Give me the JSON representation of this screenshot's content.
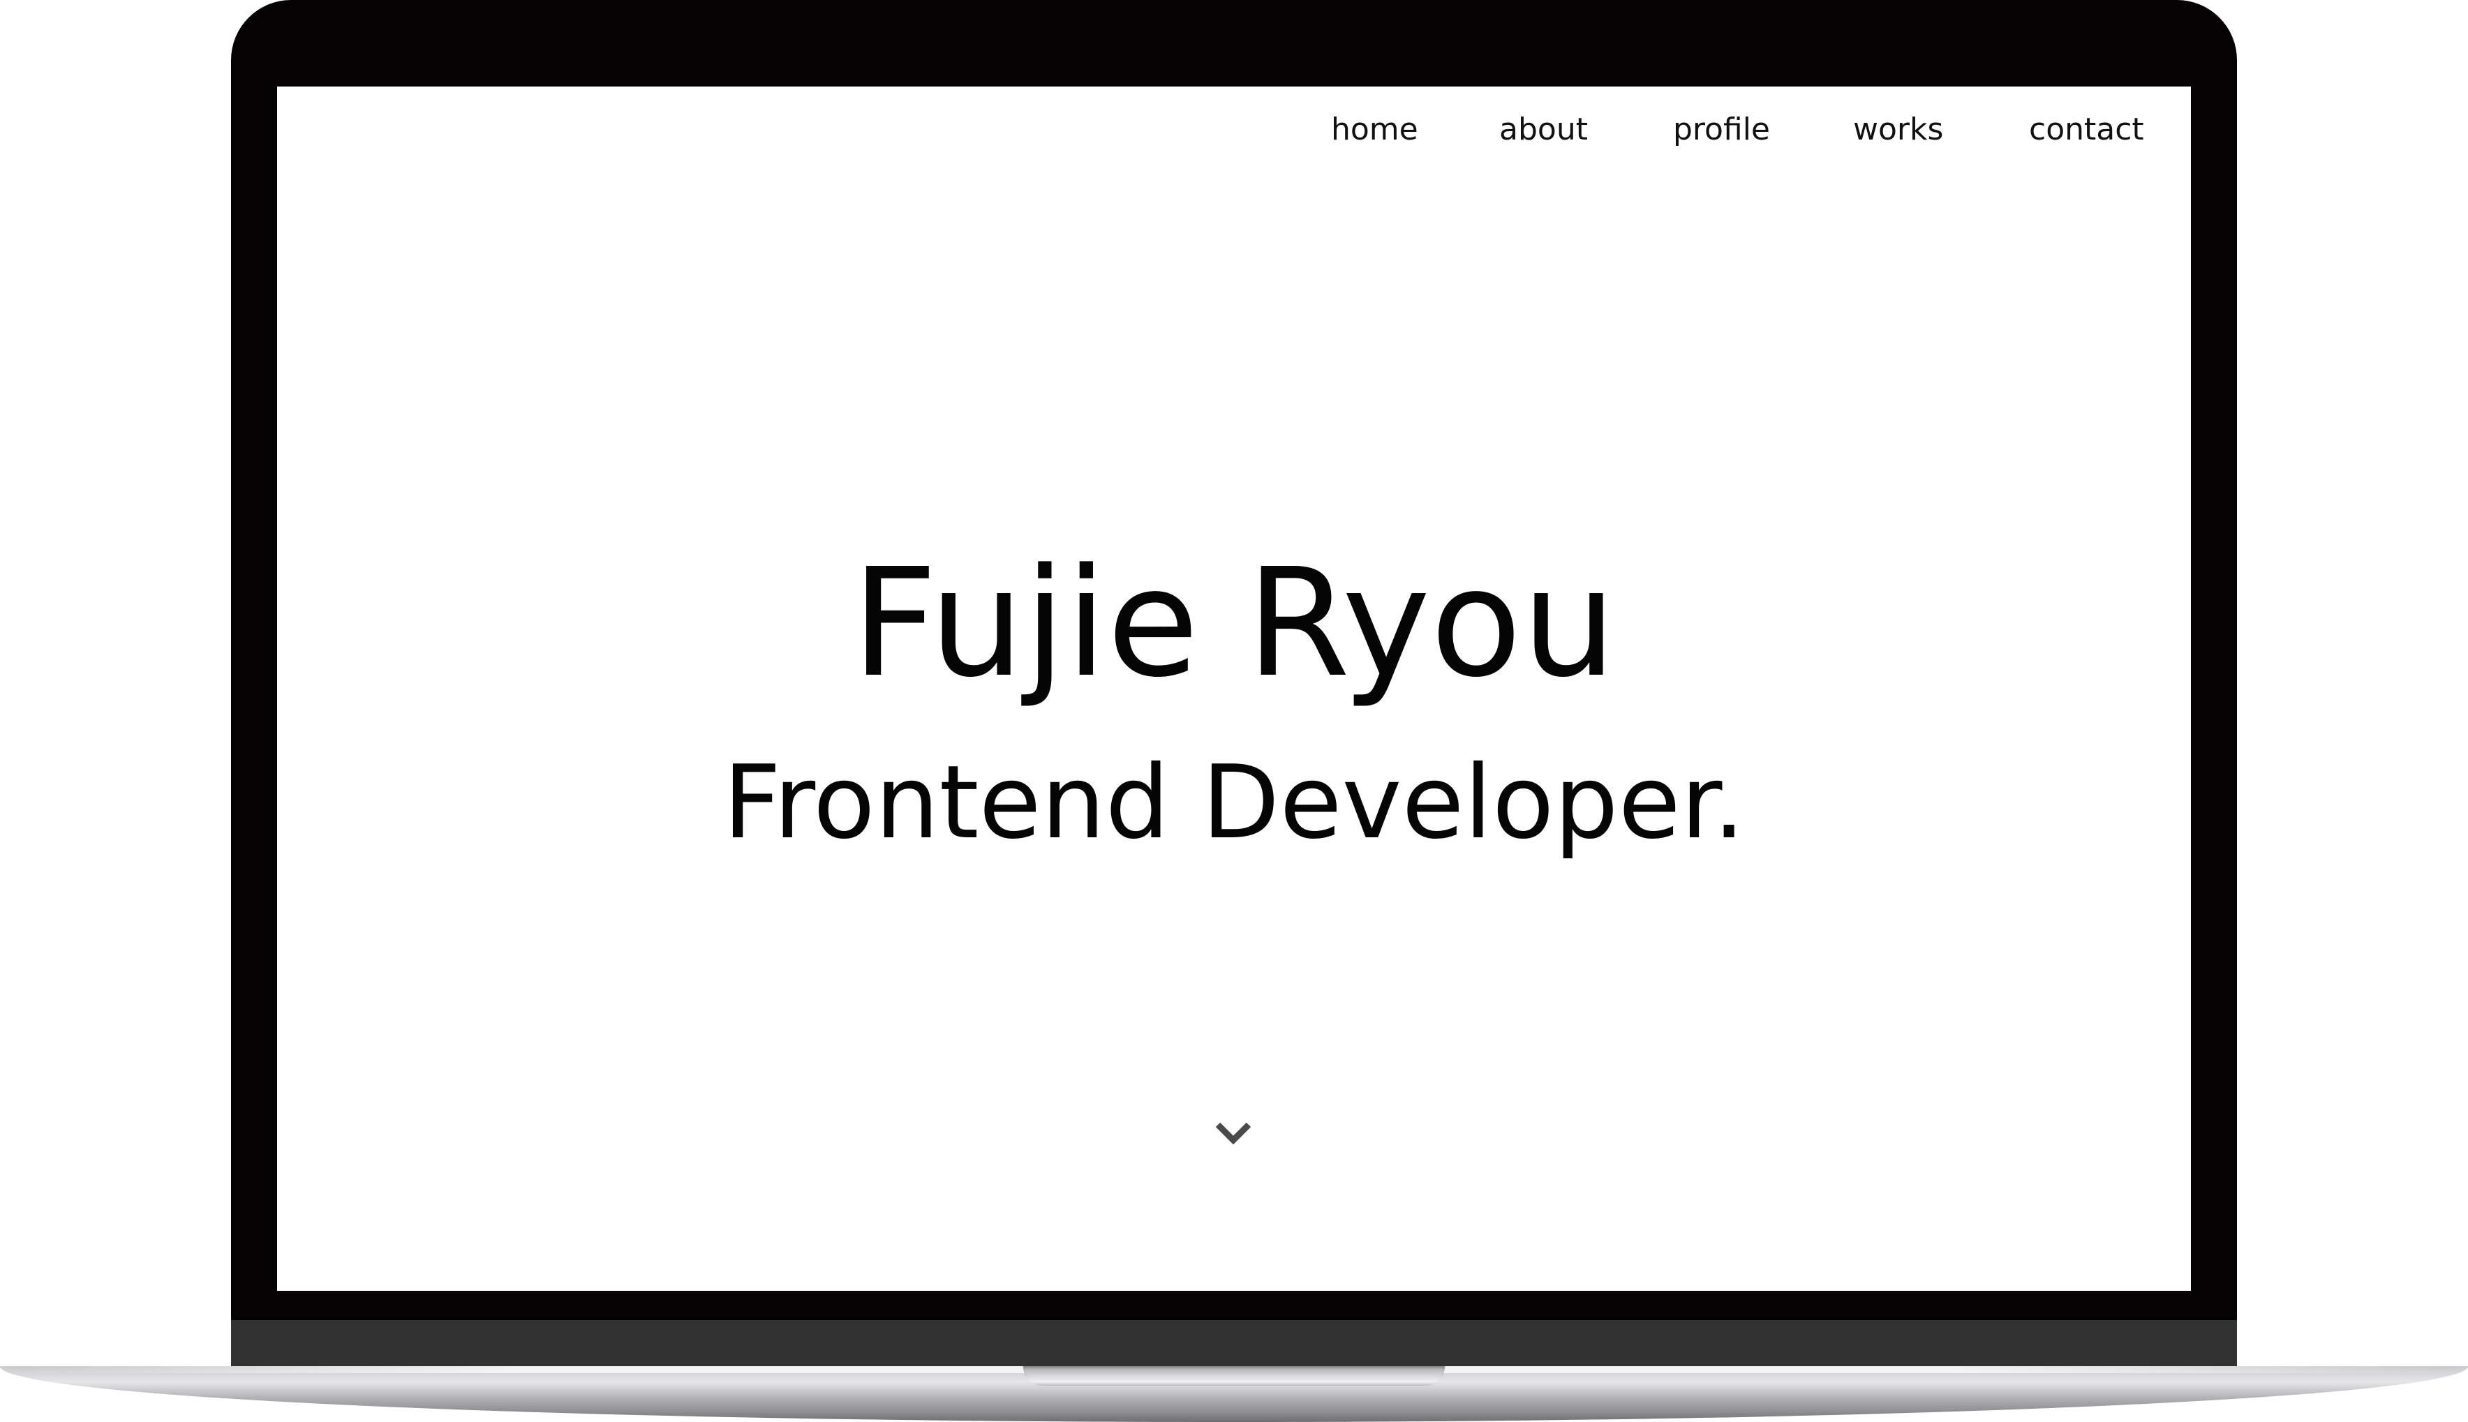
{
  "nav": {
    "items": [
      {
        "label": "home"
      },
      {
        "label": "about"
      },
      {
        "label": "profile"
      },
      {
        "label": "works"
      },
      {
        "label": "contact"
      }
    ]
  },
  "hero": {
    "name": "Fujie Ryou",
    "role": "Frontend Developer."
  },
  "scroll": {
    "icon": "chevron-down-icon"
  },
  "colors": {
    "bezel": "#050203",
    "bezel_bottom": "#323232",
    "screen_background": "#ffffff",
    "text": "#050505",
    "chevron": "#4a4a4a"
  }
}
